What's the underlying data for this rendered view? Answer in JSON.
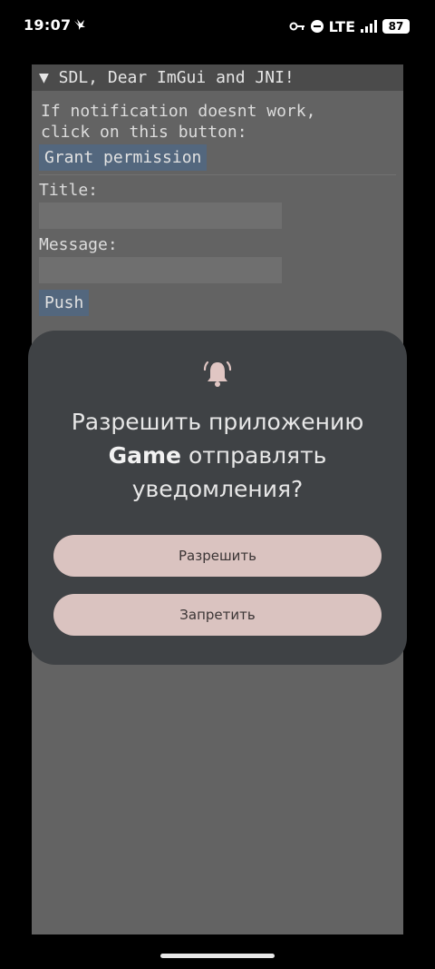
{
  "status_bar": {
    "time": "19:07",
    "network": "LTE",
    "battery": "87",
    "icons": [
      "bird-icon",
      "key-icon",
      "dnd-icon",
      "signal-icon",
      "battery-icon"
    ]
  },
  "imgui": {
    "window_title": "▼ SDL, Dear ImGui and JNI!",
    "notice_line1": "If notification doesnt work,",
    "notice_line2": "click on this button:",
    "grant_button": "Grant permission",
    "title_label": "Title:",
    "title_value": "",
    "message_label": "Message:",
    "message_value": "",
    "push_button": "Push"
  },
  "dialog": {
    "icon": "bell-icon",
    "text_before": "Разрешить приложению",
    "app_name": "Game",
    "text_after": "отправлять уведомления?",
    "allow_button": "Разрешить",
    "deny_button": "Запретить"
  },
  "colors": {
    "dialog_bg": "#3f4245",
    "button_bg": "#dac3c0",
    "imgui_button": "#53677e"
  }
}
